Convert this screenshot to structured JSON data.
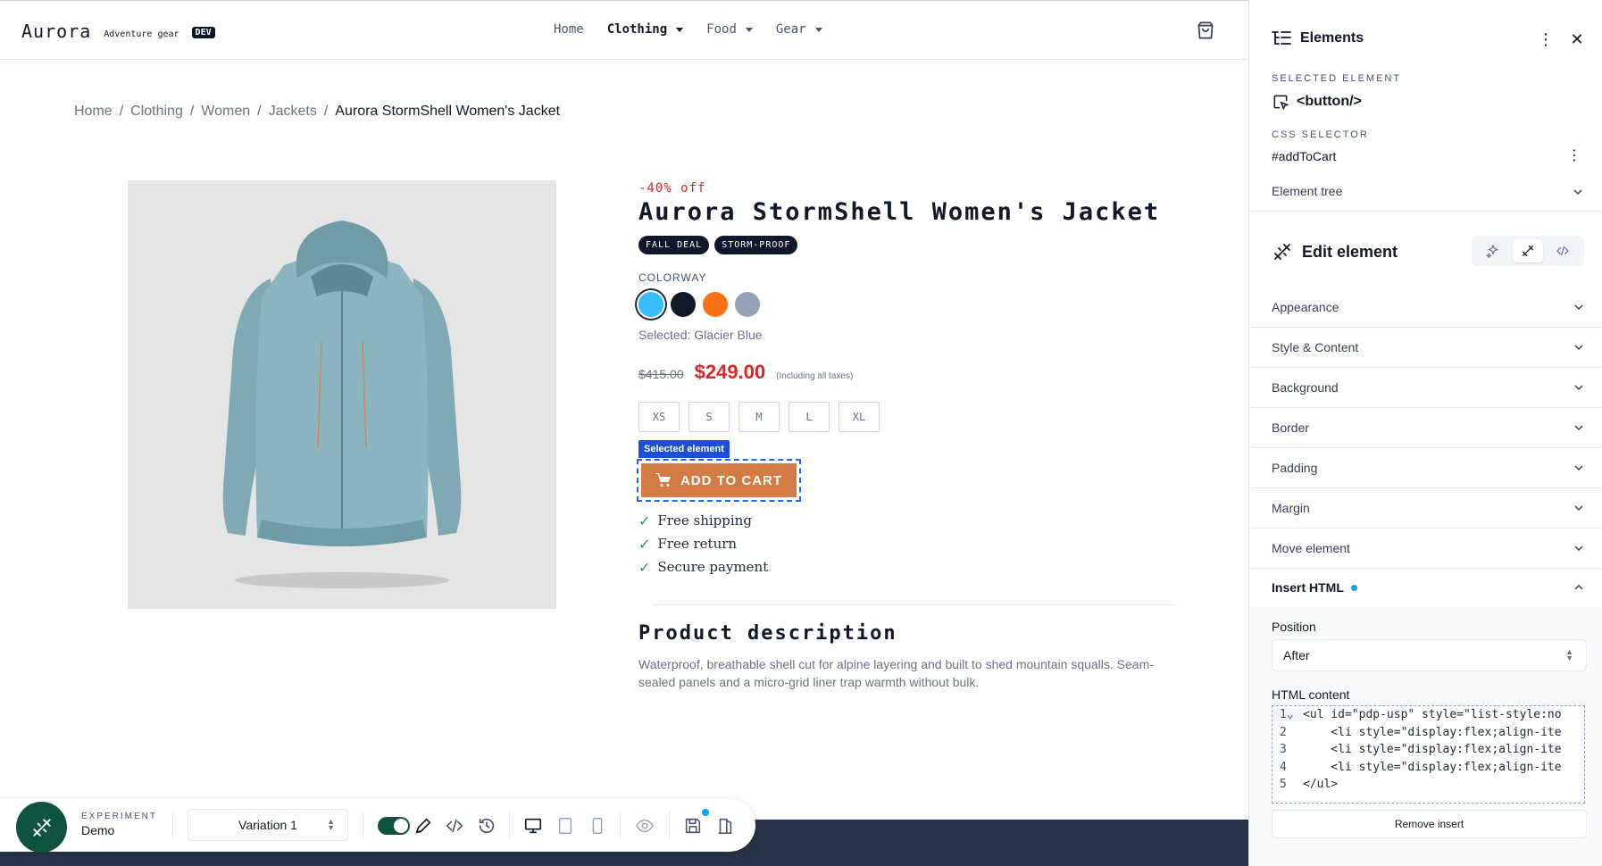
{
  "store": {
    "brand_name": "Aurora",
    "brand_tagline": "Adventure gear",
    "env_badge": "DEV",
    "nav": [
      {
        "label": "Home",
        "active": false,
        "dropdown": false
      },
      {
        "label": "Clothing",
        "active": true,
        "dropdown": true
      },
      {
        "label": "Food",
        "active": false,
        "dropdown": true
      },
      {
        "label": "Gear",
        "active": false,
        "dropdown": true
      }
    ],
    "cart_icon": "shopping-bag-icon"
  },
  "breadcrumb": [
    "Home",
    "Clothing",
    "Women",
    "Jackets",
    "Aurora StormShell Women's Jacket"
  ],
  "breadcrumb_separator": "/",
  "product": {
    "discount": "-40% off",
    "title": "Aurora StormShell Women's Jacket",
    "badges": [
      "FALL DEAL",
      "STORM-PROOF"
    ],
    "colorway_label": "COLORWAY",
    "colors": [
      {
        "name": "Glacier Blue",
        "hex": "#38bdf8",
        "selected": true
      },
      {
        "name": "Navy",
        "hex": "#111827",
        "selected": false
      },
      {
        "name": "Orange",
        "hex": "#f97316",
        "selected": false
      },
      {
        "name": "Slate",
        "hex": "#94a3b8",
        "selected": false
      }
    ],
    "selected_color_text": "Selected: Glacier Blue",
    "old_price": "$415.00",
    "price": "$249.00",
    "tax_note": "(Including all taxes)",
    "sizes": [
      "XS",
      "S",
      "M",
      "L",
      "XL"
    ],
    "selected_element_label": "Selected element",
    "add_to_cart": "ADD TO CART",
    "usps": [
      "Free shipping",
      "Free return",
      "Secure payment"
    ],
    "description_title": "Product description",
    "description": "Waterproof, breathable shell cut for alpine layering and built to shed mountain squalls. Seam-sealed panels and a micro-grid liner trap warmth without bulk."
  },
  "toolbar": {
    "experiment_label": "EXPERIMENT",
    "experiment_name": "Demo",
    "variation": "Variation 1",
    "toggle_on": true
  },
  "panel": {
    "title": "Elements",
    "selected_element_label": "SELECTED ELEMENT",
    "selected_element": "<button/>",
    "css_selector_label": "CSS SELECTOR",
    "css_selector": "#addToCart",
    "element_tree": "Element tree",
    "edit_title": "Edit element",
    "sections": [
      "Appearance",
      "Style & Content",
      "Background",
      "Border",
      "Padding",
      "Margin",
      "Move element"
    ],
    "open_section": "Insert HTML",
    "position_label": "Position",
    "position_value": "After",
    "html_label": "HTML content",
    "code_lines": [
      "<ul id=\"pdp-usp\" style=\"list-style:no",
      "    <li style=\"display:flex;align-ite",
      "    <li style=\"display:flex;align-ite",
      "    <li style=\"display:flex;align-ite",
      "</ul>"
    ],
    "remove_button": "Remove insert"
  },
  "colors": {
    "accent_green": "#0f5240",
    "cta_orange": "#d47a45",
    "sale_red": "#dc2626",
    "selection_blue": "#2563eb"
  }
}
